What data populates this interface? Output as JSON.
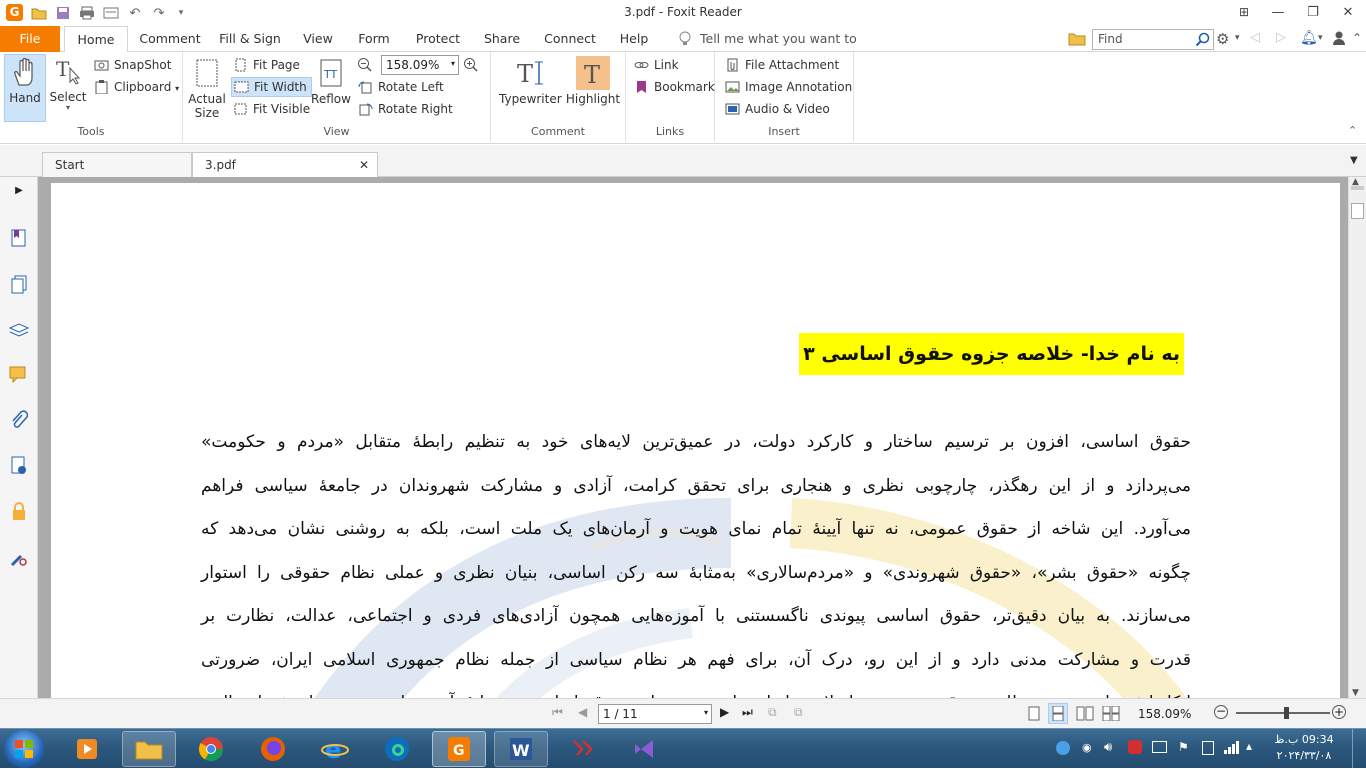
{
  "window": {
    "title": "3.pdf - Foxit Reader"
  },
  "ribbon_tabs": {
    "file": "File",
    "home": "Home",
    "comment": "Comment",
    "fill_sign": "Fill & Sign",
    "view": "View",
    "form": "Form",
    "protect": "Protect",
    "share": "Share",
    "connect": "Connect",
    "help": "Help",
    "tell_me": "Tell me what you want to do..",
    "find_placeholder": "Find"
  },
  "tools_group": {
    "label": "Tools",
    "hand": "Hand",
    "select": "Select",
    "snapshot": "SnapShot",
    "clipboard": "Clipboard"
  },
  "view_group": {
    "label": "View",
    "actual_size_1": "Actual",
    "actual_size_2": "Size",
    "fit_page": "Fit Page",
    "fit_width": "Fit Width",
    "fit_visible": "Fit Visible",
    "reflow": "Reflow",
    "zoom": "158.09%",
    "rotate_left": "Rotate Left",
    "rotate_right": "Rotate Right"
  },
  "comment_group": {
    "label": "Comment",
    "typewriter": "Typewriter",
    "highlight": "Highlight"
  },
  "links_group": {
    "label": "Links",
    "link": "Link",
    "bookmark": "Bookmark"
  },
  "insert_group": {
    "label": "Insert",
    "file_attachment": "File Attachment",
    "image_annotation": "Image Annotation",
    "audio_video": "Audio & Video"
  },
  "doc_tabs": [
    {
      "label": "Start"
    },
    {
      "label": "3.pdf"
    }
  ],
  "document": {
    "heading": "به نام خدا-  خلاصه جزوه حقوق اساسی ۳",
    "lines": [
      "حقوق اساسی، افزون بر ترسیم ساختار و کارکرد دولت، در عمیق‌ترین لایه‌های خود به تنظیم رابطهٔ متقابل «مردم و حکومت»",
      "می‌پردازد و از این رهگذر، چارچوبی نظری و هنجاری برای تحقق کرامت، آزادی و مشارکت شهروندان در جامعهٔ سیاسی فراهم",
      "می‌آورد. این شاخه از حقوق عمومی، نه تنها آیینهٔ تمام نمای هویت و آرمان‌های یک ملت است، بلکه به روشنی نشان می‌دهد که",
      "چگونه «حقوق بشر»، «حقوق شهروندی» و «مردم‌سالاری» به‌مثابهٔ سه رکن اساسی، بنیان نظری و عملی نظام حقوقی را استوار",
      "می‌سازند. به بیان دقیق‌تر، حقوق اساسی پیوندی ناگسستنی با آموزه‌هایی همچون آزادی‌های فردی و اجتماعی، عدالت، نظارت بر",
      "قدرت و مشارکت مدنی دارد و از این رو، درک آن، برای فهم هر نظام سیاسی از جمله نظام جمهوری اسلامی ایران، ضرورتی",
      "انکارناپذیر است. در نظام حقوقی جمهوری اسلامی ایران، این جزوه از حقوق اساسی بر پایهٔ آموزه‌های دینی و ارزش‌های الهی"
    ]
  },
  "statusbar": {
    "page_indicator": "1 / 11",
    "zoom": "158.09%"
  },
  "clock": {
    "time": "09:34 ب.ظ",
    "date": "۲۰۲۴/۳۳/۰۸"
  },
  "colors": {
    "accent": "#f57c00",
    "highlight": "#ffff00",
    "selected": "#cde3f7"
  }
}
